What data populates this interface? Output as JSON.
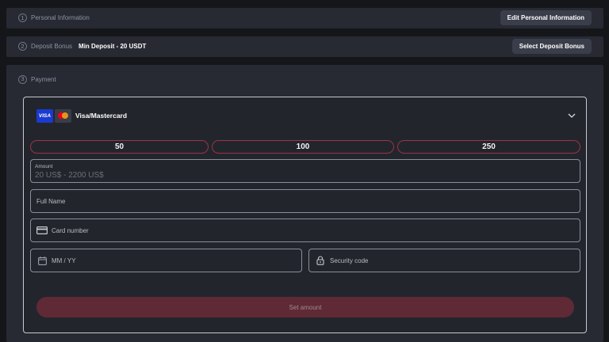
{
  "steps": [
    {
      "number": "1",
      "label": "Personal Information",
      "button": "Edit Personal Information"
    },
    {
      "number": "2",
      "label": "Deposit Bonus",
      "sub": "Min Deposit - 20 USDT",
      "button": "Select Deposit Bonus"
    },
    {
      "number": "3",
      "label": "Payment"
    }
  ],
  "payment": {
    "method": {
      "name": "Visa/Mastercard",
      "visa_text": "VISA",
      "icons": [
        "visa-logo",
        "mastercard-logo",
        "chevron-down-icon"
      ]
    },
    "presets": [
      "50",
      "100",
      "250"
    ],
    "amount": {
      "label": "Amount",
      "placeholder": "20 US$ - 2200 US$"
    },
    "full_name": {
      "placeholder": "Full Name"
    },
    "card_number": {
      "placeholder": "Card number",
      "icon": "credit-card-icon"
    },
    "expiry": {
      "placeholder": "MM / YY",
      "icon": "calendar-icon"
    },
    "security_code": {
      "placeholder": "Security code",
      "icon": "lock-icon"
    },
    "submit_label": "Set amount"
  },
  "colors": {
    "background": "#15161a",
    "panel": "#272a33",
    "accent_border": "#9b3441",
    "submit_disabled": "#5f2a35"
  }
}
